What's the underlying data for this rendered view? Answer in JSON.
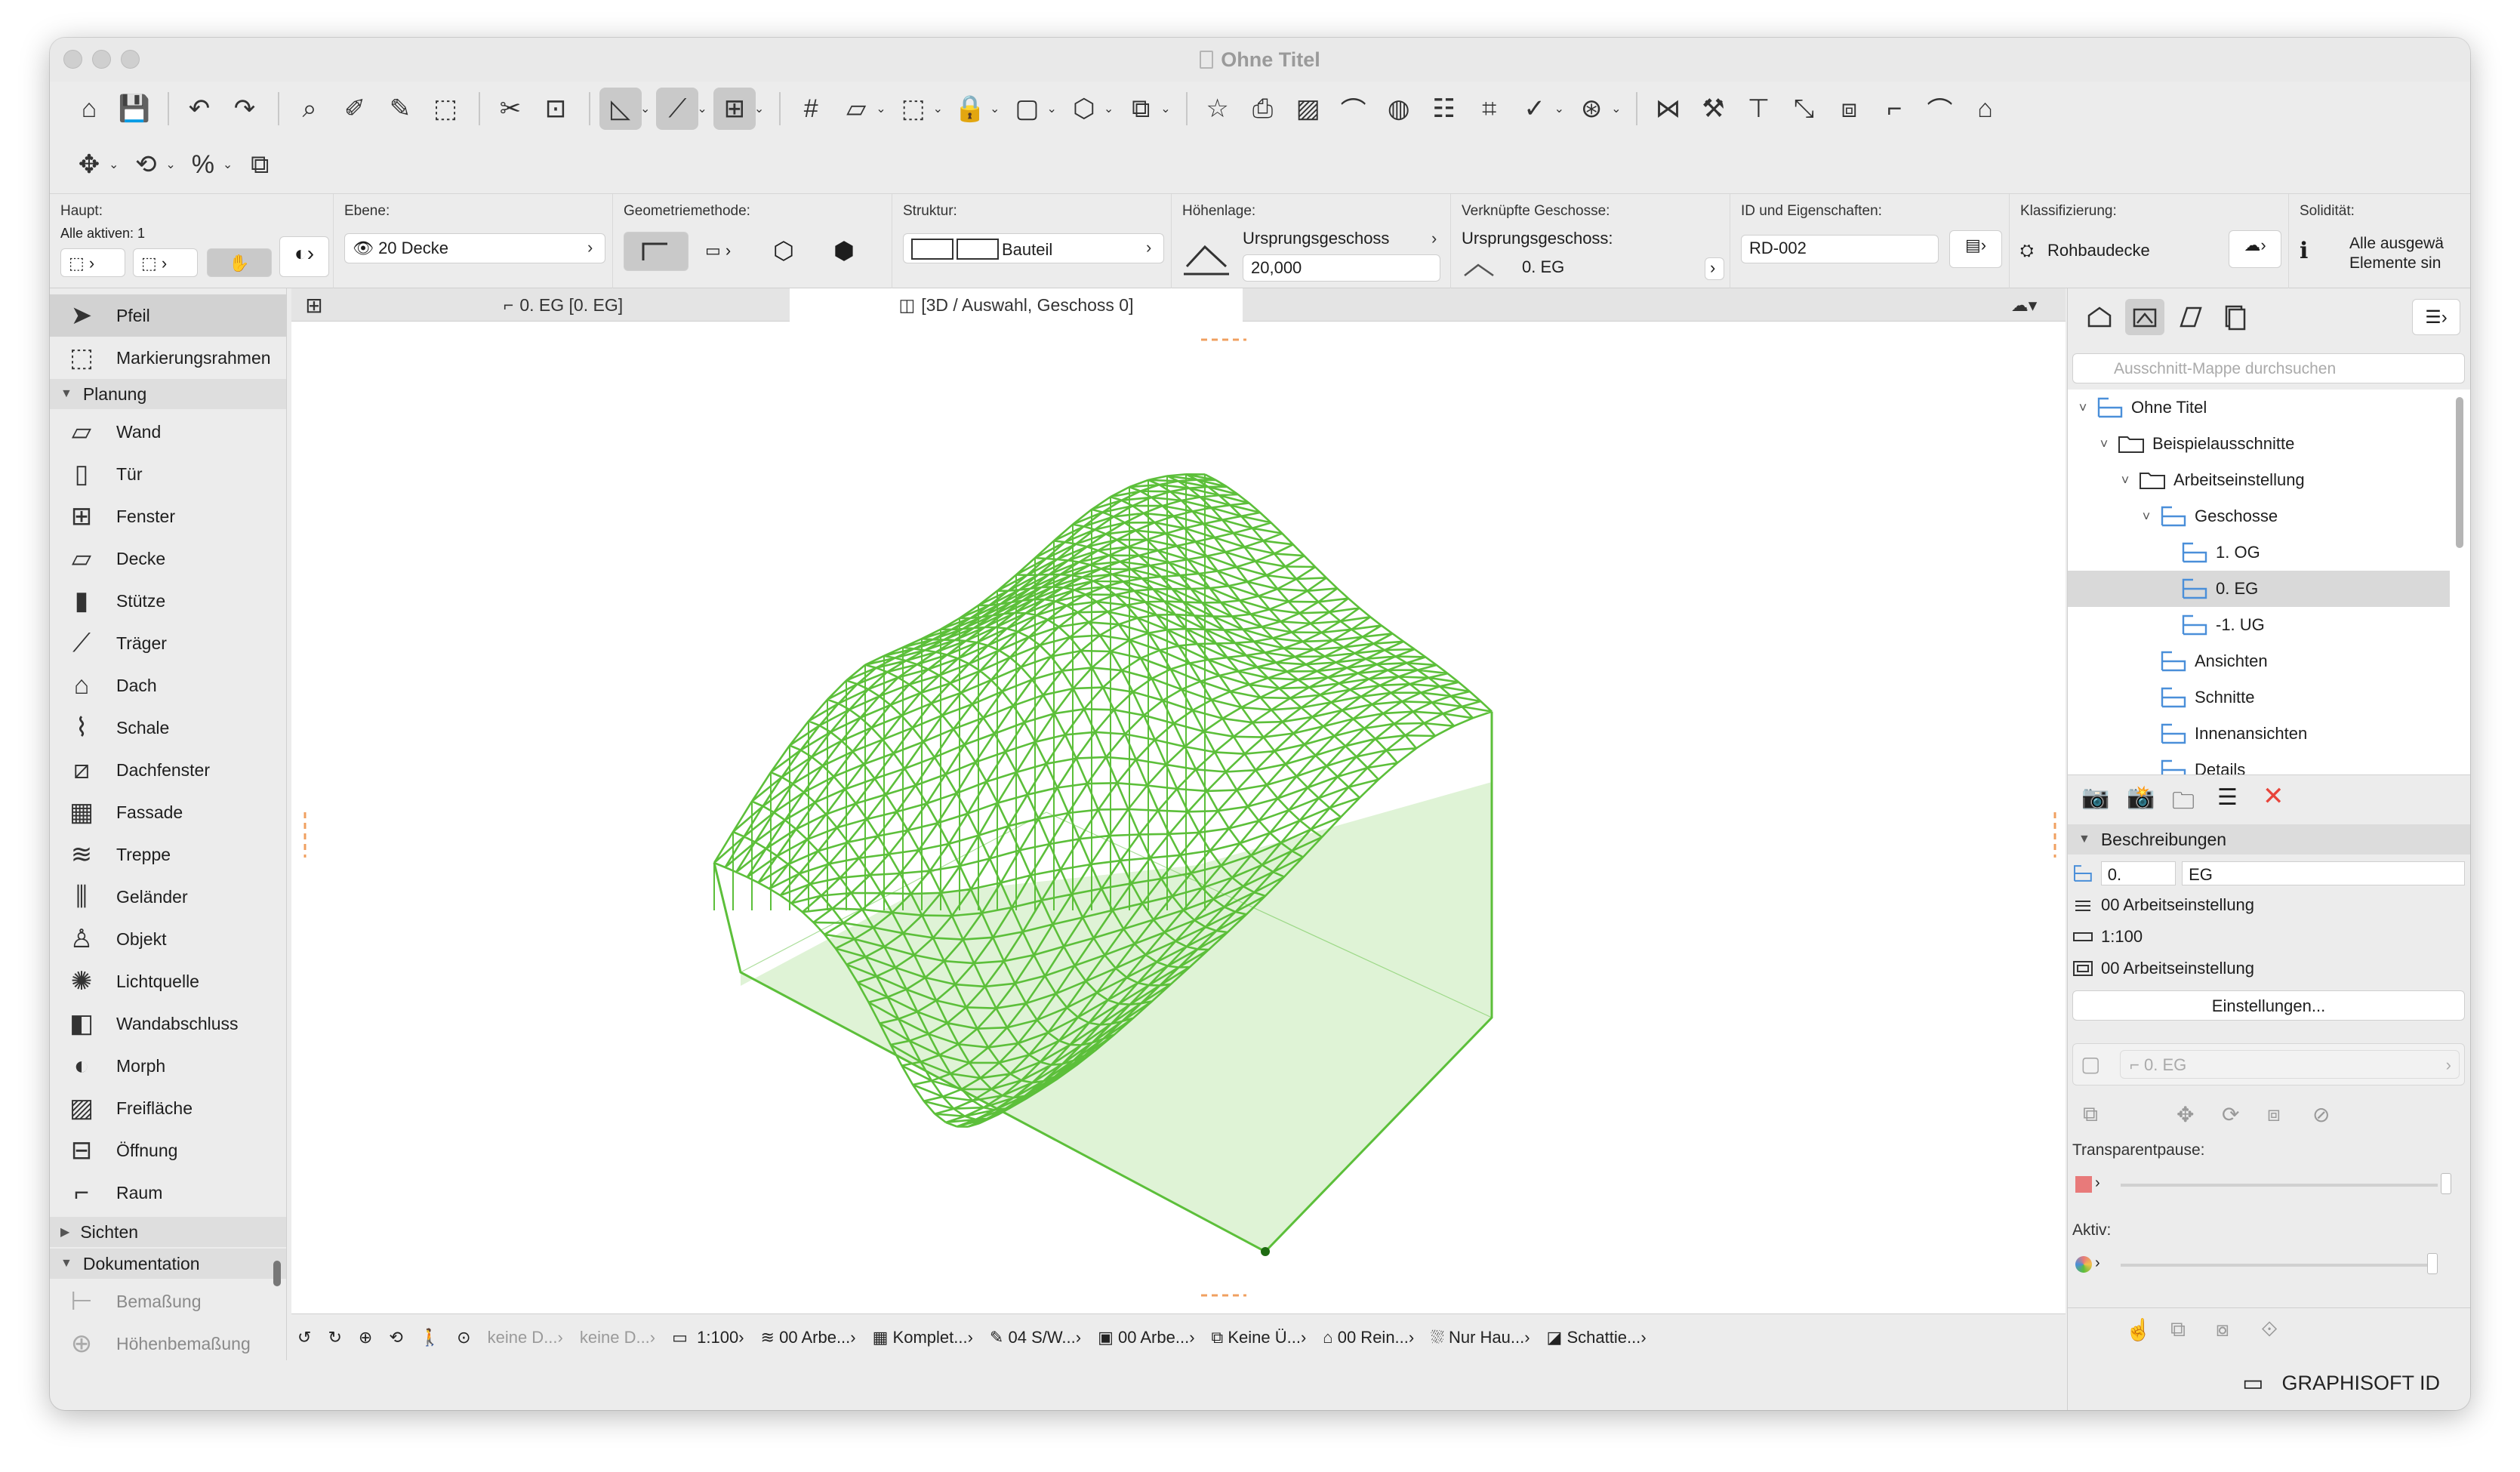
{
  "window": {
    "title": "Ohne Titel"
  },
  "infobox": {
    "haupt_label": "Haupt:",
    "alle_aktiven": "Alle aktiven: 1",
    "ebene_label": "Ebene:",
    "ebene_value": "20 Decke",
    "geometrie_label": "Geometriemethode:",
    "struktur_label": "Struktur:",
    "struktur_value": "Bauteil",
    "hoehenlage_label": "Höhenlage:",
    "ursprungsgeschoss_label": "Ursprungsgeschoss",
    "hoehe_value": "20,000",
    "verknuepfte_label": "Verknüpfte Geschosse:",
    "ursprungsgeschoss2": "Ursprungsgeschoss:",
    "geschoss_value": "0. EG",
    "id_label": "ID und Eigenschaften:",
    "id_value": "RD-002",
    "klass_label": "Klassifizierung:",
    "klass_value": "Rohbaudecke",
    "solid_label": "Solidität:",
    "solid_line1": "Alle ausgewä",
    "solid_line2": "Elemente sin"
  },
  "toolbox": {
    "tools_top": [
      {
        "label": "Pfeil",
        "icon": "arrow-pointer-icon"
      },
      {
        "label": "Markierungsrahmen",
        "icon": "marquee-icon"
      }
    ],
    "group_planung": "Planung",
    "planung_tools": [
      {
        "label": "Wand",
        "icon": "wall-icon"
      },
      {
        "label": "Tür",
        "icon": "door-icon"
      },
      {
        "label": "Fenster",
        "icon": "window-icon"
      },
      {
        "label": "Decke",
        "icon": "slab-icon"
      },
      {
        "label": "Stütze",
        "icon": "column-icon"
      },
      {
        "label": "Träger",
        "icon": "beam-icon"
      },
      {
        "label": "Dach",
        "icon": "roof-icon"
      },
      {
        "label": "Schale",
        "icon": "shell-icon"
      },
      {
        "label": "Dachfenster",
        "icon": "skylight-icon"
      },
      {
        "label": "Fassade",
        "icon": "curtain-wall-icon"
      },
      {
        "label": "Treppe",
        "icon": "stair-icon"
      },
      {
        "label": "Geländer",
        "icon": "railing-icon"
      },
      {
        "label": "Objekt",
        "icon": "object-icon"
      },
      {
        "label": "Lichtquelle",
        "icon": "lamp-icon"
      },
      {
        "label": "Wandabschluss",
        "icon": "wall-end-icon"
      },
      {
        "label": "Morph",
        "icon": "morph-icon"
      },
      {
        "label": "Freifläche",
        "icon": "mesh-icon"
      },
      {
        "label": "Öffnung",
        "icon": "opening-icon"
      },
      {
        "label": "Raum",
        "icon": "zone-icon"
      }
    ],
    "group_sichten": "Sichten",
    "group_dokumentation": "Dokumentation",
    "doku_tools": [
      {
        "label": "Bemaßung",
        "icon": "dimension-icon"
      },
      {
        "label": "Höhenbemaßung",
        "icon": "level-dimension-icon"
      }
    ]
  },
  "tabs": [
    {
      "label": "0. EG [0. EG]"
    },
    {
      "label": "[3D / Auswahl, Geschoss 0]"
    }
  ],
  "statusbar": {
    "layer_combo1": "keine D...",
    "layer_combo2": "keine D...",
    "scale": "1:100",
    "item1": "00 Arbe...",
    "item2": "Komplet...",
    "item3": "04 S/W...",
    "item4": "00 Arbe...",
    "item5": "Keine Ü...",
    "item6": "00 Rein...",
    "item7": "Nur Hau...",
    "item8": "Schattie..."
  },
  "navigator": {
    "search_placeholder": "Ausschnitt-Mappe durchsuchen",
    "tree": [
      {
        "label": "Ohne Titel",
        "depth": 0,
        "arrow": "˅"
      },
      {
        "label": "Beispielausschnitte",
        "depth": 1,
        "arrow": "˅"
      },
      {
        "label": "Arbeitseinstellung",
        "depth": 2,
        "arrow": "˅"
      },
      {
        "label": "Geschosse",
        "depth": 3,
        "arrow": "˅"
      },
      {
        "label": "1. OG",
        "depth": 4,
        "arrow": ""
      },
      {
        "label": "0. EG",
        "depth": 4,
        "arrow": ""
      },
      {
        "label": "-1. UG",
        "depth": 4,
        "arrow": ""
      },
      {
        "label": "Ansichten",
        "depth": 3,
        "arrow": ""
      },
      {
        "label": "Schnitte",
        "depth": 3,
        "arrow": ""
      },
      {
        "label": "Innenansichten",
        "depth": 3,
        "arrow": ""
      },
      {
        "label": "Details",
        "depth": 3,
        "arrow": ""
      }
    ],
    "beschreibungen": "Beschreibungen",
    "id_prefix": "0.",
    "id_name": "EG",
    "layer_combo": "00 Arbeitseinstellung",
    "scale": "1:100",
    "model_view": "00 Arbeitseinstellung",
    "einstellungen": "Einstellungen...",
    "geschoss_field": "0. EG",
    "transparentpause": "Transparentpause:",
    "aktiv": "Aktiv:",
    "brand": "GRAPHISOFT ID"
  },
  "colors": {
    "mesh_green": "#5cbf3a",
    "mesh_fill": "#dff3d6",
    "pause_red": "#e87a7a",
    "delete_red": "#e8443a"
  }
}
